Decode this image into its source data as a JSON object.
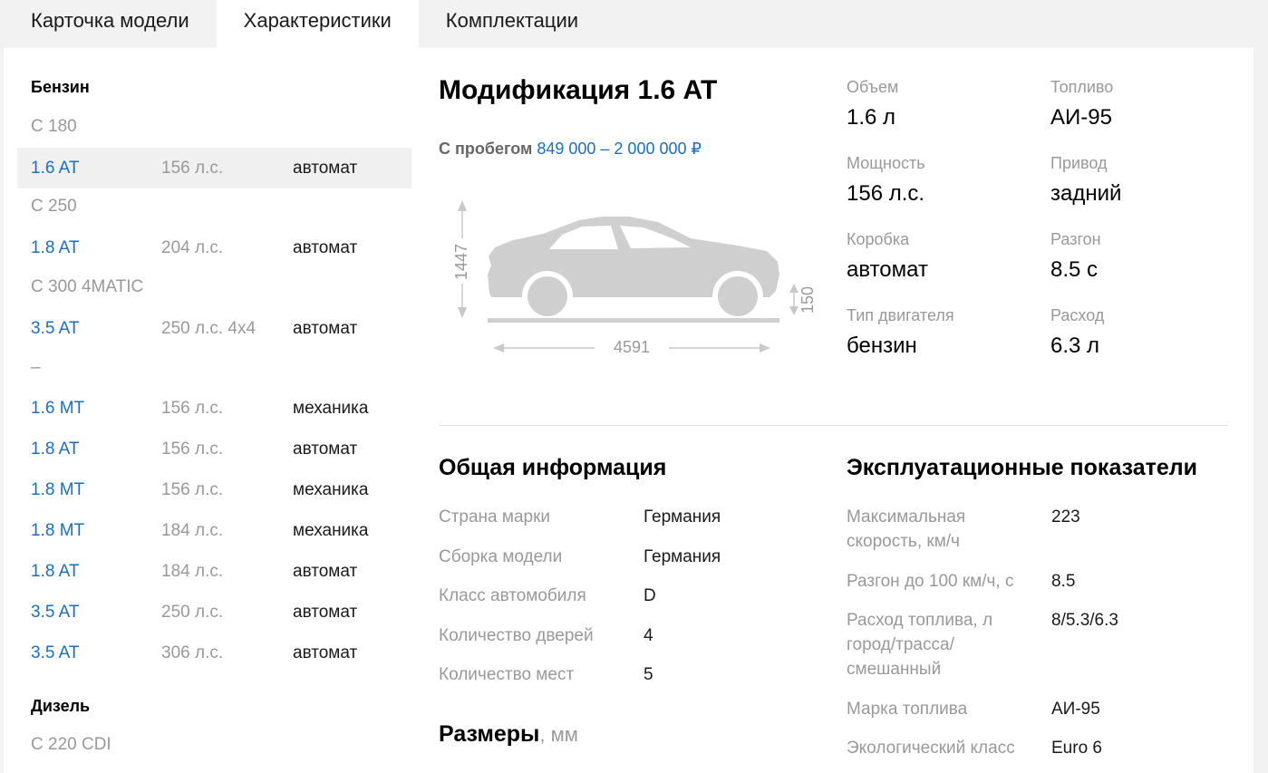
{
  "tabs": [
    {
      "label": "Карточка модели"
    },
    {
      "label": "Характеристики"
    },
    {
      "label": "Комплектации"
    }
  ],
  "sidebar": {
    "petrol_heading": "Бензин",
    "diesel_heading": "Дизель",
    "groups": {
      "c180": "C 180",
      "c250": "C 250",
      "c300": "C 300 4MATIC",
      "dash": "–",
      "c220": "C 220 CDI"
    },
    "rows": [
      {
        "name": "1.6 AT",
        "hp": "156 л.с.",
        "trans": "автомат"
      },
      {
        "name": "1.8 AT",
        "hp": "204 л.с.",
        "trans": "автомат"
      },
      {
        "name": "3.5 AT",
        "hp": "250 л.с. 4x4",
        "trans": "автомат"
      },
      {
        "name": "1.6 MT",
        "hp": "156 л.с.",
        "trans": "механика"
      },
      {
        "name": "1.8 AT",
        "hp": "156 л.с.",
        "trans": "автомат"
      },
      {
        "name": "1.8 MT",
        "hp": "156 л.с.",
        "trans": "механика"
      },
      {
        "name": "1.8 MT",
        "hp": "184 л.с.",
        "trans": "механика"
      },
      {
        "name": "1.8 AT",
        "hp": "184 л.с.",
        "trans": "автомат"
      },
      {
        "name": "3.5 AT",
        "hp": "250 л.с.",
        "trans": "автомат"
      },
      {
        "name": "3.5 AT",
        "hp": "306 л.с.",
        "trans": "автомат"
      }
    ]
  },
  "main": {
    "title": "Модификация 1.6 AT",
    "price_label": "С пробегом",
    "price_value": "849 000 – 2 000 000 ₽",
    "dims": {
      "height": "1447",
      "length": "4591",
      "clearance": "150"
    },
    "specs": [
      {
        "label": "Объем",
        "value": "1.6 л"
      },
      {
        "label": "Топливо",
        "value": "АИ-95"
      },
      {
        "label": "Мощность",
        "value": "156 л.с."
      },
      {
        "label": "Привод",
        "value": "задний"
      },
      {
        "label": "Коробка",
        "value": "автомат"
      },
      {
        "label": "Разгон",
        "value": "8.5 с"
      },
      {
        "label": "Тип двигателя",
        "value": "бензин"
      },
      {
        "label": "Расход",
        "value": "6.3 л"
      }
    ],
    "general_title": "Общая информация",
    "general": [
      {
        "label": "Страна марки",
        "value": "Германия"
      },
      {
        "label": "Сборка модели",
        "value": "Германия"
      },
      {
        "label": "Класс автомобиля",
        "value": "D"
      },
      {
        "label": "Количество дверей",
        "value": "4"
      },
      {
        "label": "Количество мест",
        "value": "5"
      }
    ],
    "sizes_title": "Размеры",
    "sizes_unit": ", мм",
    "perf_title": "Эксплуатационные показатели",
    "perf": [
      {
        "label": "Максимальная скорость, км/ч",
        "value": "223"
      },
      {
        "label": "Разгон до 100 км/ч, с",
        "value": "8.5"
      },
      {
        "label": "Расход топлива, л город/трасса/ смешанный",
        "value": "8/5.3/6.3"
      },
      {
        "label": "Марка топлива",
        "value": "АИ-95"
      },
      {
        "label": "Экологический класс",
        "value": "Euro 6"
      }
    ]
  }
}
